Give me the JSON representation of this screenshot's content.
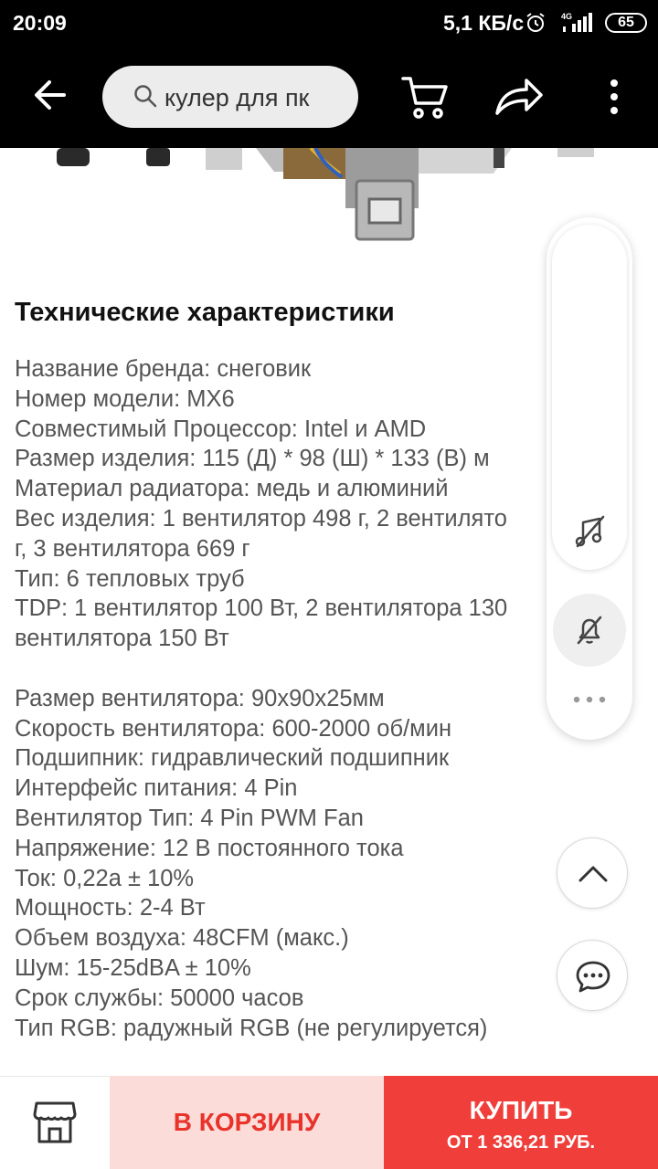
{
  "status_bar": {
    "time": "20:09",
    "network_speed": "5,1 КБ/с",
    "network_type": "4G",
    "battery": "65"
  },
  "header": {
    "search_query": "кулер для пк",
    "icons": [
      "back-arrow-icon",
      "search-icon",
      "cart-icon",
      "share-icon",
      "more-vertical-icon"
    ]
  },
  "specs": {
    "title": "Технические характеристики",
    "lines": [
      "Название бренда: снеговик",
      "Номер модели: MX6",
      "Совместимый Процессор: Intel и AMD",
      "Размер изделия: 115 (Д) * 98 (Ш) * 133 (В) м",
      "Материал радиатора: медь и алюминий",
      "Вес изделия: 1 вентилятор 498 г, 2 вентилято",
      "г, 3 вентилятора 669 г",
      "Тип: 6 тепловых труб",
      "TDP: 1 вентилятор 100 Вт, 2 вентилятора 130",
      "вентилятора 150 Вт"
    ],
    "lines2": [
      "Размер вентилятора: 90x90x25мм",
      "Скорость вентилятора: 600-2000 об/мин",
      "Подшипник: гидравлический подшипник",
      "Интерфейс питания: 4 Pin",
      "Вентилятор Тип: 4 Pin PWM Fan",
      "Напряжение: 12 В постоянного тока",
      "Ток: 0,22а ± 10%",
      "Мощность: 2-4 Вт",
      "Объем воздуха: 48CFM (макс.)",
      "Шум: 15-25dBA ± 10%",
      "Срок службы: 50000 часов",
      "Тип RGB: радужный RGB (не регулируется)"
    ]
  },
  "bottom_bar": {
    "add_to_cart": "В КОРЗИНУ",
    "buy_label": "КУПИТЬ",
    "buy_price": "ОТ 1 336,21 РУБ."
  },
  "colors": {
    "accent": "#f03f3b",
    "cart_bg": "#fcdcd9",
    "cart_text": "#e8322a"
  }
}
